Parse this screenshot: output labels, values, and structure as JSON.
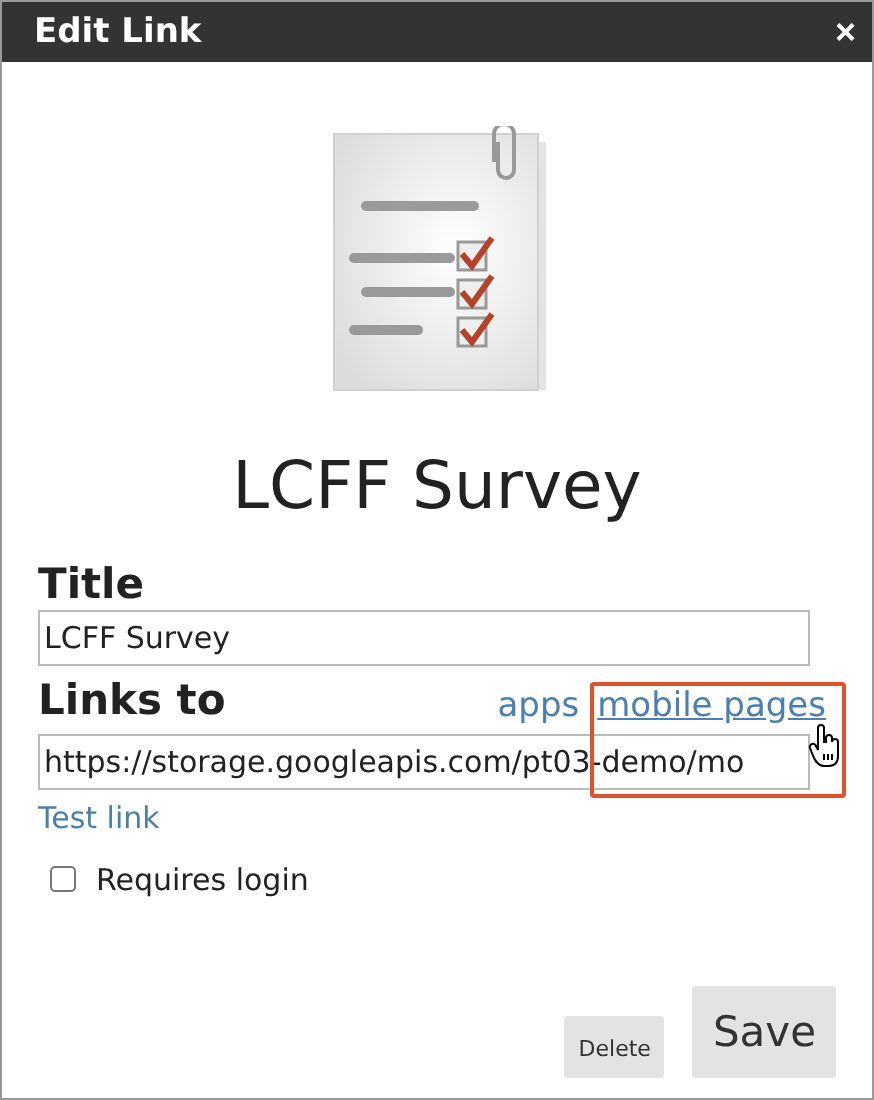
{
  "dialog": {
    "title": "Edit Link",
    "close": "×"
  },
  "item": {
    "name": "LCFF Survey"
  },
  "title_field": {
    "label": "Title",
    "value": "LCFF Survey"
  },
  "link_field": {
    "label": "Links to",
    "value": "https://storage.googleapis.com/pt03-demo/mo",
    "sources": [
      {
        "label": "apps",
        "hovered": false
      },
      {
        "label": "mobile pages",
        "hovered": true
      }
    ]
  },
  "test_link": "Test link",
  "requires_login": {
    "label": "Requires login",
    "checked": false
  },
  "buttons": [
    {
      "label": "Delete",
      "kind": "secondary"
    },
    {
      "label": "Save",
      "kind": "primary"
    }
  ]
}
